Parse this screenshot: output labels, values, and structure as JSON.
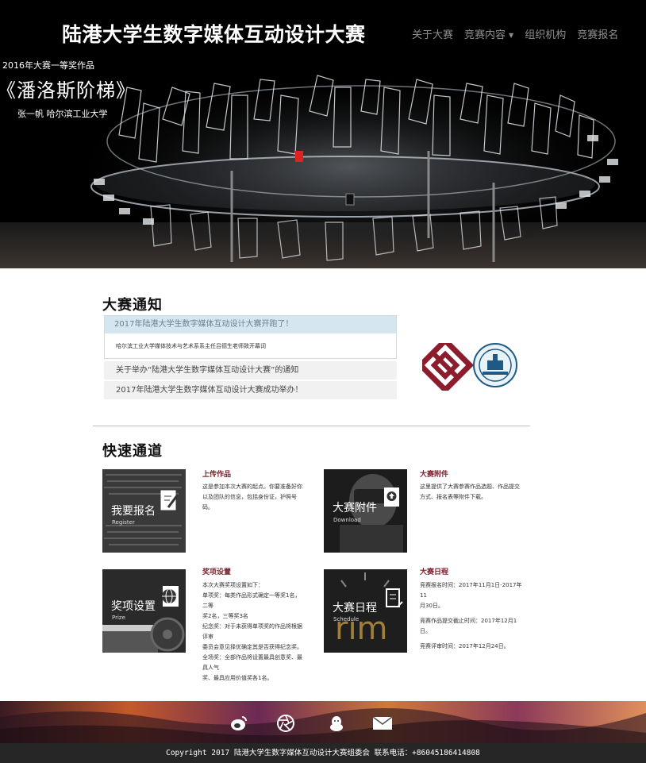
{
  "header": {
    "site_title": "陆港大学生数字媒体互动设计大赛",
    "nav": [
      "关于大赛",
      "竞赛内容",
      "组织机构",
      "竞赛报名"
    ]
  },
  "hero": {
    "award_label": "2016年大赛一等奖作品",
    "work_title": "《潘洛斯阶梯》",
    "work_author": "张一帆 哈尔滨工业大学"
  },
  "notices": {
    "heading": "大赛通知",
    "featured_title": "2017年陆港大学生数字媒体互动设计大赛开跑了！",
    "featured_body": "哈尔滨工业大学媒体技术与艺术系系主任吕德生老师致开幕词",
    "items": [
      "关于举办“陆港大学生数字媒体互动设计大赛”的通知",
      "2017年陆港大学生数字媒体互动设计大赛成功举办！"
    ]
  },
  "quick": {
    "heading": "快速通道",
    "cards": [
      {
        "tile_label": "我要报名",
        "tile_sub": "Register",
        "icon": "pencil-document-icon",
        "title": "上传作品",
        "desc": [
          "这是参加本次大赛的起点。你要准备好你",
          "以及团队的信息，包括身份证，护照号码。"
        ]
      },
      {
        "tile_label": "大赛附件",
        "tile_sub": "Download",
        "icon": "upload-document-icon",
        "title": "大赛附件",
        "desc": [
          "这里提供了大赛参赛作品选题、作品提交",
          "方式、报名表等附件下载。"
        ]
      },
      {
        "tile_label": "奖项设置",
        "tile_sub": "Prize",
        "icon": "globe-document-icon",
        "title": "奖项设置",
        "desc": [
          "本次大赛奖项设置如下：",
          "单项奖：每类作品形式确定一等奖1名，二等",
          "奖2名，三等奖3名",
          "纪念奖：对于未获得单项奖的作品将根据评审",
          "委员会意见择优确定其是否获得纪念奖。",
          "全场奖：全部作品将设置最具创意奖、最具人气",
          "奖、最具应用价值奖各1名。"
        ]
      },
      {
        "tile_label": "大赛日程",
        "tile_sub": "Schedule",
        "icon": "calendar-document-icon",
        "title": "大赛日程",
        "desc": [
          "竞赛报名时间：2017年11月1日-2017年11",
          "月30日。",
          "",
          "竞赛作品提交截止时间：2017年12月1日。",
          "",
          "竞赛评审时间：2017年12月24日。"
        ]
      }
    ]
  },
  "footer": {
    "social_icons": [
      "weibo-icon",
      "aperture-icon",
      "qq-icon",
      "mail-icon"
    ],
    "copyright": "Copyright 2017  陆港大学生数字媒体互动设计大赛组委会 联系电话：+86045186414808"
  }
}
